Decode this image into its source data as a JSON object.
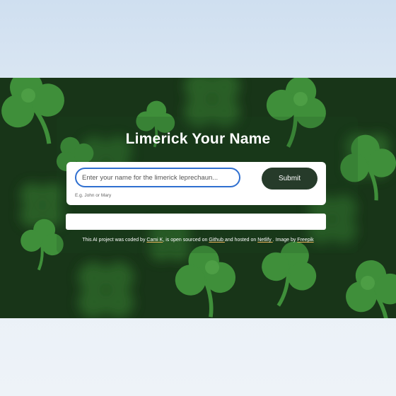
{
  "header": {
    "title": "Limerick Your Name"
  },
  "form": {
    "placeholder": "Enter your name for the limerick leprechaun...",
    "hint": "E.g. John or Mary",
    "submit_label": "Submit"
  },
  "result": {
    "text": ""
  },
  "footer": {
    "text_1": "This AI project was coded by ",
    "author_link": "Cami K",
    "text_2": ", is open sourced on ",
    "github_link": "Github ",
    "text_3": "and hosted on ",
    "netlify_link": "Netlify ",
    "text_4": ". Image by ",
    "freepik_link": "Freepik"
  },
  "colors": {
    "background_dark": "#1a3a1c",
    "clover": "#3f8f3a",
    "button": "#263b2a",
    "input_border": "#2f6fd0"
  }
}
